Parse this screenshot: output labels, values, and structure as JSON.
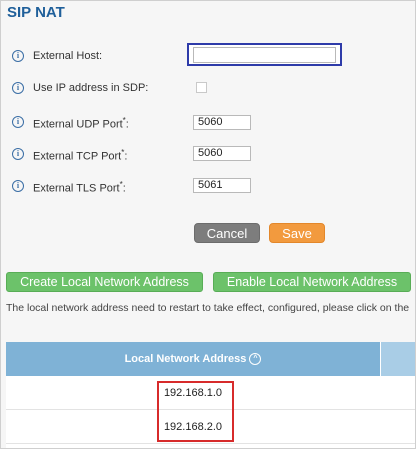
{
  "section": {
    "title": "SIP NAT"
  },
  "fields": {
    "external_host": {
      "label": "External Host:",
      "value": ""
    },
    "use_ip_sdp": {
      "label": "Use IP address in SDP:",
      "checked": false
    },
    "udp": {
      "label": "External UDP Port",
      "required": "*",
      "colon": ":",
      "value": "5060"
    },
    "tcp": {
      "label": "External TCP Port",
      "required": "*",
      "colon": ":",
      "value": "5060"
    },
    "tls": {
      "label": "External TLS Port",
      "required": "*",
      "colon": ":",
      "value": "5061"
    }
  },
  "buttons": {
    "cancel": "Cancel",
    "save": "Save",
    "create": "Create Local Network Address",
    "enable": "Enable Local Network Address"
  },
  "notice": "The local network address need to restart to take effect, configured, please click on the",
  "table": {
    "header": "Local Network Address",
    "sort_icon": "^",
    "rows": [
      "192.168.1.0",
      "192.168.2.0"
    ]
  },
  "icons": {
    "info": "info-icon",
    "sort": "chevron-up-circle-icon"
  },
  "colors": {
    "title": "#1f5f9a",
    "cancel": "#7d7d7d",
    "save": "#f29a3e",
    "green": "#6cc26a",
    "table_header": "#7fb2d6",
    "highlight_blue": "#2e3ba9",
    "highlight_red": "#d72b2b"
  }
}
